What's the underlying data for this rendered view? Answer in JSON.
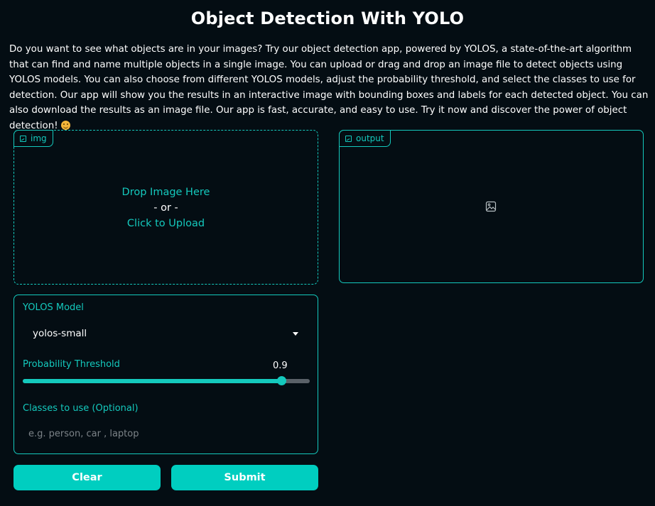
{
  "app": {
    "title": "Object Detection With YOLO",
    "description": "Do you want to see what objects are in your images? Try our object detection app, powered by YOLOS, a state-of-the-art algorithm that can find and name multiple objects in a single image. You can upload or drag and drop an image file to detect objects using YOLOS models. You can also choose from different YOLOS models, adjust the probability threshold, and select the classes to use for detection. Our app will show you the results in an interactive image with bounding boxes and labels for each detected object. You can also download the results as an image file. Our app is fast, accurate, and easy to use. Try it now and discover the power of object detection!",
    "description_emoji": "smiling-face-emoji"
  },
  "input_image": {
    "label": "img",
    "icon": "image-icon",
    "drop_text": "Drop Image Here",
    "or_text": "- or -",
    "upload_text": "Click to Upload"
  },
  "output_image": {
    "label": "output",
    "icon": "image-icon",
    "placeholder_icon": "image-placeholder-icon"
  },
  "controls": {
    "model_label": "YOLOS Model",
    "model_value": "yolos-small",
    "threshold_label": "Probability Threshold",
    "threshold_value": "0.9",
    "threshold_fraction": 0.9,
    "classes_label": "Classes to use (Optional)",
    "classes_placeholder": "e.g. person, car , laptop",
    "classes_value": ""
  },
  "buttons": {
    "clear": "Clear",
    "submit": "Submit"
  },
  "colors": {
    "accent": "#14c9bd",
    "button": "#00cec0",
    "background": "#040d13"
  }
}
